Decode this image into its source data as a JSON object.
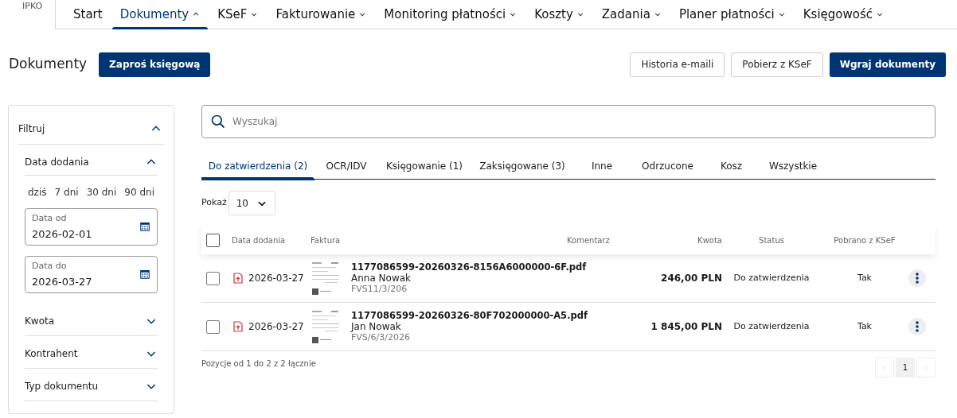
{
  "logo": "IPKO",
  "nav": [
    {
      "label": "Start",
      "selected": false,
      "has_menu": false
    },
    {
      "label": "Dokumenty",
      "selected": true,
      "has_menu": true
    },
    {
      "label": "KSeF",
      "selected": false,
      "has_menu": true
    },
    {
      "label": "Fakturowanie",
      "selected": false,
      "has_menu": true
    },
    {
      "label": "Monitoring płatności",
      "selected": false,
      "has_menu": true
    },
    {
      "label": "Koszty",
      "selected": false,
      "has_menu": true
    },
    {
      "label": "Zadania",
      "selected": false,
      "has_menu": true
    },
    {
      "label": "Planer płatności",
      "selected": false,
      "has_menu": true
    },
    {
      "label": "Księgowość",
      "selected": false,
      "has_menu": true
    }
  ],
  "page_title": "Dokumenty",
  "invite_button": "Zaproś księgową",
  "actions": [
    {
      "label": "Historia e-maili",
      "kind": "outline"
    },
    {
      "label": "Pobierz z KSeF",
      "kind": "outline"
    },
    {
      "label": "Wgraj dokumenty",
      "kind": "primary"
    }
  ],
  "filters": {
    "title": "Filtruj",
    "expanded": true,
    "sections": [
      {
        "title": "Data dodania",
        "expanded": true,
        "quick_ranges": [
          "dziś",
          "7 dni",
          "30 dni",
          "90 dni"
        ],
        "fields": [
          {
            "label": "Data od",
            "value": "2026-02-01"
          },
          {
            "label": "Data do",
            "value": "2026-03-27"
          }
        ]
      },
      {
        "title": "Kwota",
        "expanded": false
      },
      {
        "title": "Kontrahent",
        "expanded": false
      },
      {
        "title": "Typ dokumentu",
        "expanded": false
      }
    ]
  },
  "search": {
    "placeholder": "Wyszukaj"
  },
  "tabs": [
    {
      "label": "Do zatwierdzenia (2)",
      "selected": true
    },
    {
      "label": "OCR/IDV",
      "selected": false
    },
    {
      "label": "Księgowanie (1)",
      "selected": false
    },
    {
      "label": "Zaksięgowane (3)",
      "selected": false
    },
    {
      "label": "Inne",
      "selected": false
    },
    {
      "label": "Odrzucone",
      "selected": false
    },
    {
      "label": "Kosz",
      "selected": false
    },
    {
      "label": "Wszystkie",
      "selected": false
    }
  ],
  "page_size": {
    "label": "Pokaż",
    "value": "10"
  },
  "table": {
    "all_checked": false,
    "columns": [
      "Data dodania",
      "Faktura",
      "Komentarz",
      "Kwota",
      "Status",
      "Pobrano z KSeF"
    ],
    "rows": [
      {
        "checked": false,
        "date": "2026-03-27",
        "file": "1177086599-20260326-8156A6000000-6F.pdf",
        "contractor": "Anna Nowak",
        "number": "FVS11/3/206",
        "amount": "246,00 PLN",
        "status": "Do zatwierdzenia",
        "ksef": "Tak"
      },
      {
        "checked": false,
        "date": "2026-03-27",
        "file": "1177086599-20260326-80F702000000-A5.pdf",
        "contractor": "Jan Nowak",
        "number": "FVS/6/3/2026",
        "amount": "1 845,00 PLN",
        "status": "Do zatwierdzenia",
        "ksef": "Tak"
      }
    ]
  },
  "summary": "Pozycje od 1 do 2 z 2 łącznie",
  "pagination": [
    {
      "label": "1",
      "selected": true
    }
  ]
}
